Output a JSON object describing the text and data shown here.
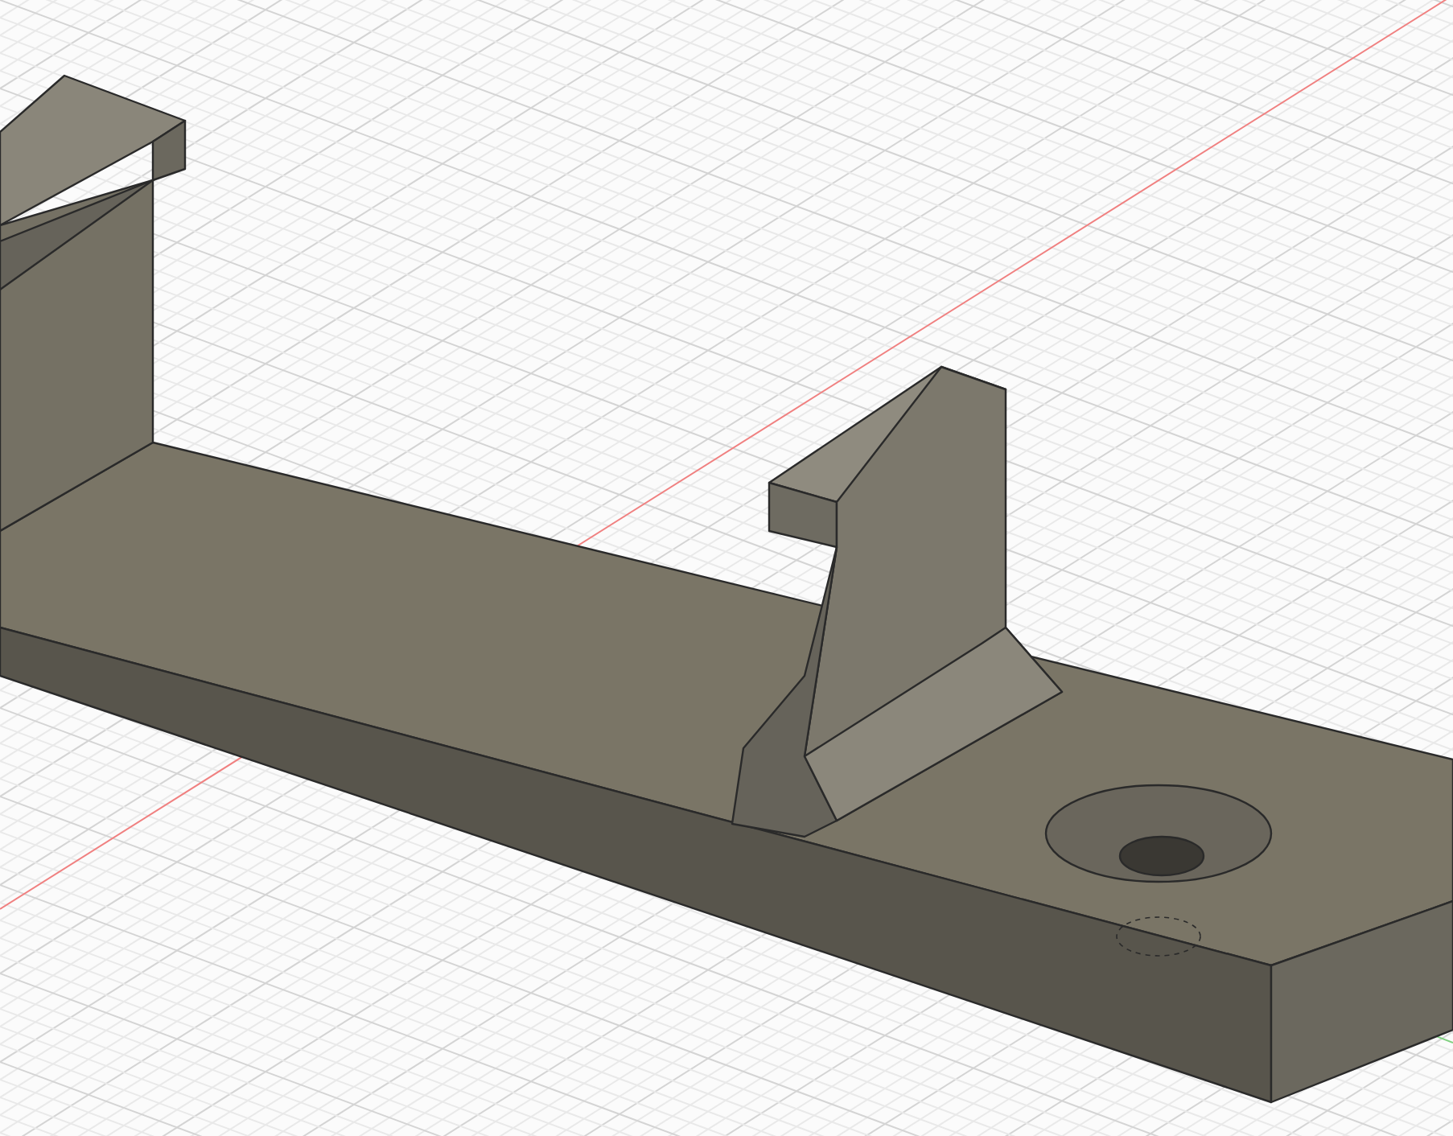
{
  "viewport": {
    "kind": "model-view",
    "grid": true
  }
}
